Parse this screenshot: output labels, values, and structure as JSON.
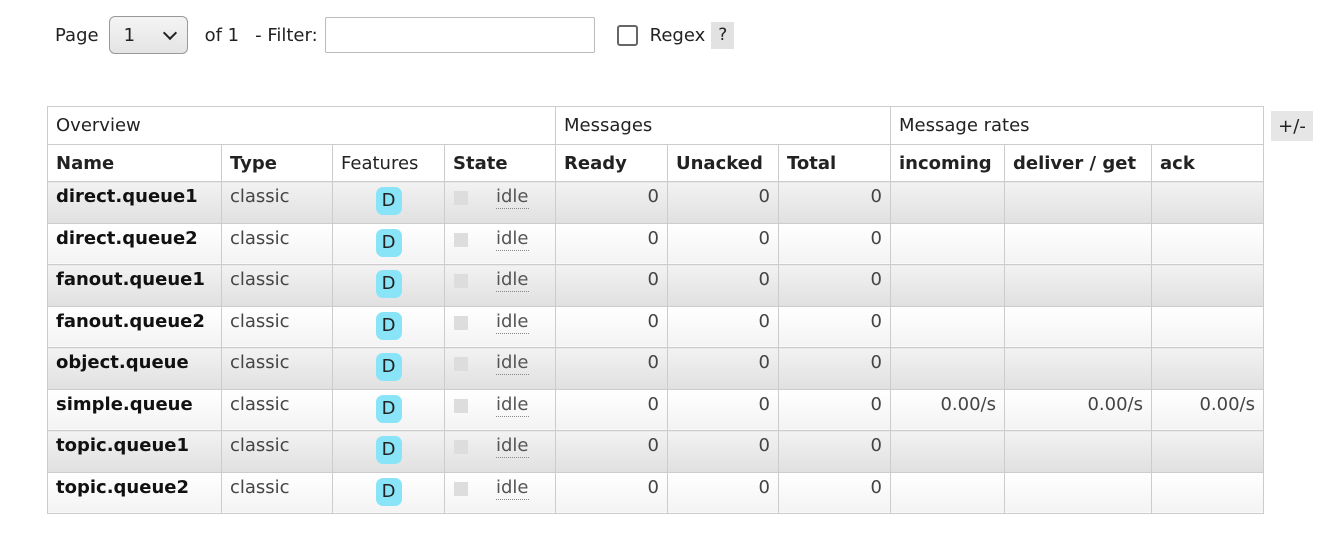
{
  "pager": {
    "page_label": "Page",
    "page_value": "1",
    "of_label": "of 1",
    "filter_label": "- Filter:",
    "filter_value": "",
    "filter_placeholder": "",
    "regex_label": "Regex",
    "regex_checked": false,
    "help_label": "?"
  },
  "table": {
    "groups": [
      "Overview",
      "Messages",
      "Message rates"
    ],
    "columns": [
      "Name",
      "Type",
      "Features",
      "State",
      "Ready",
      "Unacked",
      "Total",
      "incoming",
      "deliver / get",
      "ack"
    ],
    "toggle_label": "+/-",
    "rows": [
      {
        "name": "direct.queue1",
        "type": "classic",
        "feature": "D",
        "state": "idle",
        "ready": "0",
        "unacked": "0",
        "total": "0",
        "incoming": "",
        "deliver_get": "",
        "ack": ""
      },
      {
        "name": "direct.queue2",
        "type": "classic",
        "feature": "D",
        "state": "idle",
        "ready": "0",
        "unacked": "0",
        "total": "0",
        "incoming": "",
        "deliver_get": "",
        "ack": ""
      },
      {
        "name": "fanout.queue1",
        "type": "classic",
        "feature": "D",
        "state": "idle",
        "ready": "0",
        "unacked": "0",
        "total": "0",
        "incoming": "",
        "deliver_get": "",
        "ack": ""
      },
      {
        "name": "fanout.queue2",
        "type": "classic",
        "feature": "D",
        "state": "idle",
        "ready": "0",
        "unacked": "0",
        "total": "0",
        "incoming": "",
        "deliver_get": "",
        "ack": ""
      },
      {
        "name": "object.queue",
        "type": "classic",
        "feature": "D",
        "state": "idle",
        "ready": "0",
        "unacked": "0",
        "total": "0",
        "incoming": "",
        "deliver_get": "",
        "ack": ""
      },
      {
        "name": "simple.queue",
        "type": "classic",
        "feature": "D",
        "state": "idle",
        "ready": "0",
        "unacked": "0",
        "total": "0",
        "incoming": "0.00/s",
        "deliver_get": "0.00/s",
        "ack": "0.00/s"
      },
      {
        "name": "topic.queue1",
        "type": "classic",
        "feature": "D",
        "state": "idle",
        "ready": "0",
        "unacked": "0",
        "total": "0",
        "incoming": "",
        "deliver_get": "",
        "ack": ""
      },
      {
        "name": "topic.queue2",
        "type": "classic",
        "feature": "D",
        "state": "idle",
        "ready": "0",
        "unacked": "0",
        "total": "0",
        "incoming": "",
        "deliver_get": "",
        "ack": ""
      }
    ]
  },
  "colors": {
    "feature_badge": "#8ae4f8",
    "row_alt": "#e8e8e8",
    "border": "#cccccc"
  }
}
